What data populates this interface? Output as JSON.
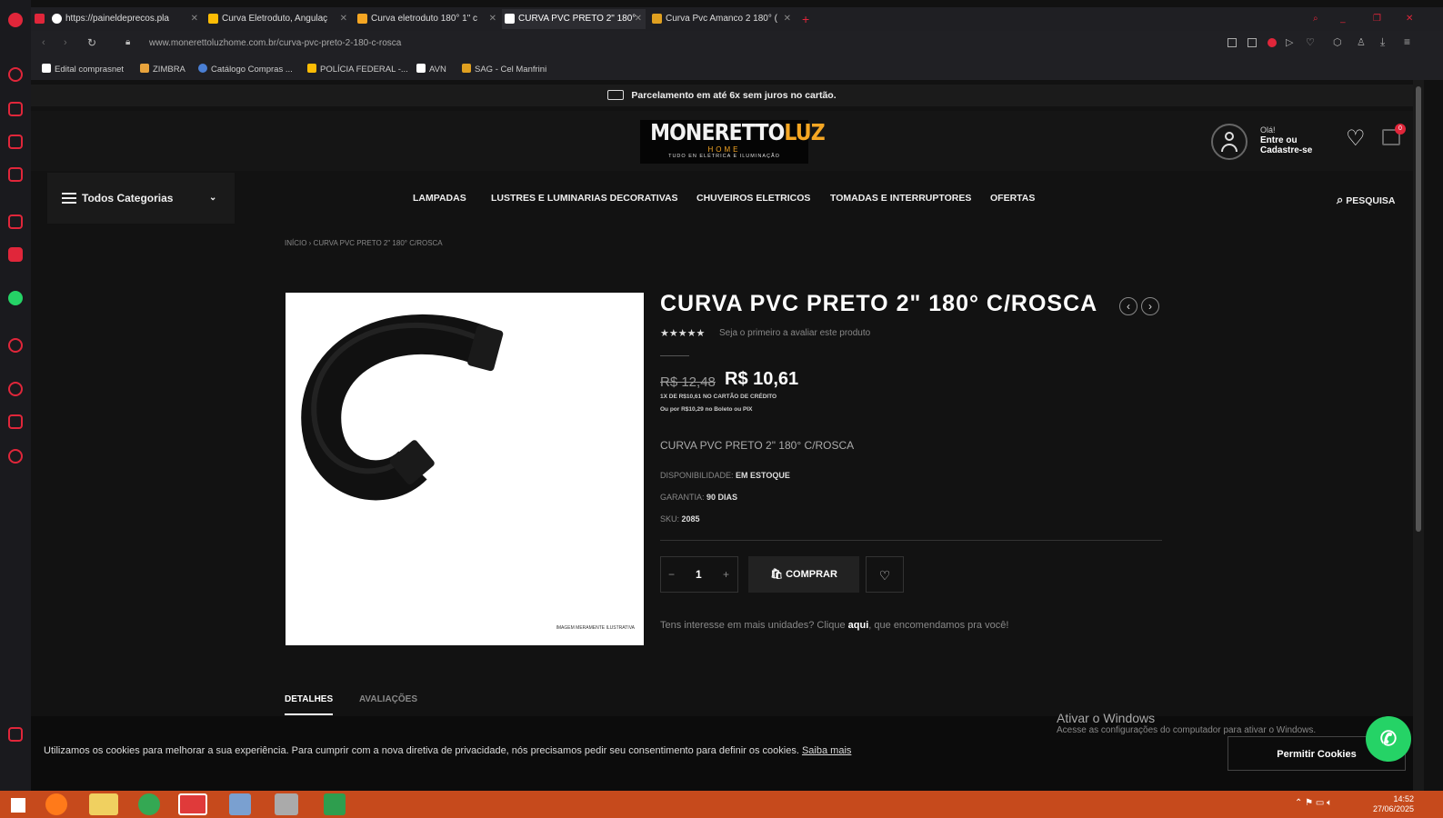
{
  "browser": {
    "tabs": [
      {
        "label": "https://painelde​precos.pla",
        "color": "#4285f4"
      },
      {
        "label": "Curva Eletroduto, Angulaç",
        "color": "#fbbc05"
      },
      {
        "label": "Curva eletroduto 180° 1\" c",
        "color": "#f5a623"
      },
      {
        "label": "CURVA PVC PRETO 2\" 180°",
        "color": "#222222"
      },
      {
        "label": "Curva Pvc Amanco 2 180° (",
        "color": "#e0a020"
      }
    ],
    "url": "www.monerettoluzhome.com.br/curva-pvc-preto-2-180-c-rosca",
    "bookmarks": [
      "Edital comprasnet",
      "ZIMBRA",
      "Catálogo Compras ...",
      "POLÍCIA FEDERAL -...",
      "AVN",
      "SAG - Cel Manfrini"
    ]
  },
  "site": {
    "promo": "Parcelamento em até 6x sem juros no cartão.",
    "logo": {
      "part1": "MONERETTO",
      "part2": "LUZ",
      "sub": "HOME",
      "tagline": "TUDO EN ELÉTRICA E ILUMINAÇÃO"
    },
    "account": {
      "greeting": "Olá!",
      "action": "Entre ou Cadastre-se"
    },
    "cart_count": "0",
    "categories_label": "Todos Categorias",
    "nav": [
      "LAMPADAS",
      "LUSTRES E LUMINARIAS DECORATIVAS",
      "CHUVEIROS ELETRICOS",
      "TOMADAS E INTERRUPTORES",
      "OFERTAS"
    ],
    "search_label": "PESQUISA",
    "breadcrumb": "INÍCIO  ›  CURVA PVC PRETO 2\" 180° C/ROSCA"
  },
  "product": {
    "title": "CURVA PVC PRETO 2\" 180° C/ROSCA",
    "rating_text": "Seja o primeiro a avaliar este produto",
    "old_price": "R$ 12,48",
    "price": "R$ 10,61",
    "installments": "1X DE R$10,61 NO CARTÃO DE CRÉDITO",
    "cash_price": "Ou por R$10,29 no Boleto ou PIX",
    "short_desc": "CURVA PVC PRETO 2\" 180° C/ROSCA",
    "availability_label": "DISPONIBILIDADE:",
    "availability": "EM ESTOQUE",
    "warranty_label": "GARANTIA:",
    "warranty": "90 DIAS",
    "sku_label": "SKU:",
    "sku": "2085",
    "quantity": "1",
    "buy_label": "COMPRAR",
    "more_units_pre": "Tens interesse em mais unidades? Clique",
    "more_units_link": "aqui",
    "more_units_post": ", que encomendamos pra você!",
    "image_caption": "IMAGEM MERAMENTE ILUSTRATIVA",
    "tabs": [
      "DETALHES",
      "AVALIAÇÕES"
    ]
  },
  "cookie": {
    "text": "Utilizamos os cookies para melhorar a sua experiência. Para cumprir com a nova diretiva de privacidade, nós precisamos pedir seu consentimento para definir os cookies.",
    "link": "Saiba mais",
    "button": "Permitir Cookies"
  },
  "windows": {
    "activate_title": "Ativar o Windows",
    "activate_sub": "Acesse as configurações do computador para ativar o Windows.",
    "time": "14:52",
    "date": "27/06/2025"
  }
}
